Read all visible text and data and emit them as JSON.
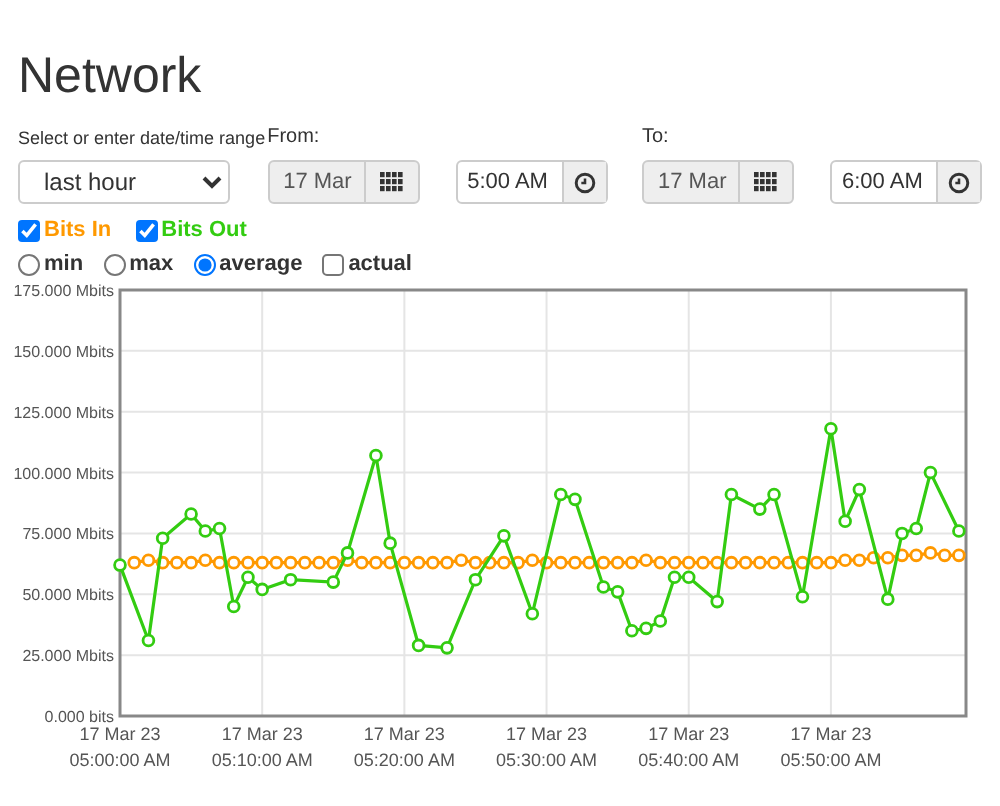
{
  "title": "Network",
  "range": {
    "label": "Select or enter date/time range",
    "value": "last hour"
  },
  "from": {
    "label": "From:",
    "date": "17 Mar",
    "time": "5:00 AM"
  },
  "to": {
    "label": "To:",
    "date": "17 Mar",
    "time": "6:00 AM"
  },
  "series_toggles": [
    {
      "checked": true
    },
    {
      "checked": true
    }
  ],
  "modes": [
    {
      "label": "min",
      "kind": "radio",
      "selected": false
    },
    {
      "label": "max",
      "kind": "radio",
      "selected": false
    },
    {
      "label": "average",
      "kind": "radio",
      "selected": true
    },
    {
      "label": "actual",
      "kind": "checkbox",
      "selected": false
    }
  ],
  "chart": {
    "chart_data": {
      "type": "line",
      "categories": [
        "17 Mar 23 05:00:00 AM",
        null,
        null,
        null,
        null,
        null,
        null,
        null,
        null,
        null,
        "17 Mar 23 05:10:00 AM",
        null,
        null,
        null,
        null,
        null,
        null,
        null,
        null,
        null,
        "17 Mar 23 05:20:00 AM",
        null,
        null,
        null,
        null,
        null,
        null,
        null,
        null,
        null,
        "17 Mar 23 05:30:00 AM",
        null,
        null,
        null,
        null,
        null,
        null,
        null,
        null,
        null,
        "17 Mar 23 05:40:00 AM",
        null,
        null,
        null,
        null,
        null,
        null,
        null,
        null,
        null,
        "17 Mar 23 05:50:00 AM",
        null,
        null,
        null,
        null,
        null,
        null,
        null,
        null,
        null
      ],
      "ylim": [
        0,
        175
      ],
      "grid": true,
      "yticks": [
        {
          "value": 0,
          "label": "0.000 bits"
        },
        {
          "value": 25,
          "label": "25.000 Mbits"
        },
        {
          "value": 50,
          "label": "50.000 Mbits"
        },
        {
          "value": 75,
          "label": "75.000 Mbits"
        },
        {
          "value": 100,
          "label": "100.000 Mbits"
        },
        {
          "value": 125,
          "label": "125.000 Mbits"
        },
        {
          "value": 150,
          "label": "150.000 Mbits"
        },
        {
          "value": 175,
          "label": "175.000 Mbits"
        }
      ],
      "series": [
        {
          "name": "Bits In",
          "color": "#ff9900",
          "marker": "circle",
          "values": [
            null,
            63,
            64,
            63,
            63,
            63,
            64,
            63,
            63,
            63,
            63,
            63,
            63,
            63,
            63,
            63,
            64,
            63,
            63,
            63,
            63,
            63,
            63,
            63,
            64,
            63,
            63,
            63,
            63,
            64,
            63,
            63,
            63,
            63,
            63,
            63,
            63,
            64,
            63,
            63,
            63,
            63,
            63,
            63,
            63,
            63,
            63,
            63,
            63,
            63,
            63,
            64,
            64,
            65,
            65,
            66,
            66,
            67,
            66,
            66
          ]
        },
        {
          "name": "Bits Out",
          "color": "#33cc11",
          "marker": "circle",
          "values": [
            62,
            null,
            31,
            73,
            null,
            83,
            76,
            77,
            45,
            57,
            52,
            null,
            56,
            null,
            null,
            55,
            67,
            null,
            107,
            71,
            null,
            29,
            null,
            28,
            null,
            56,
            null,
            74,
            null,
            42,
            null,
            91,
            89,
            null,
            53,
            51,
            35,
            36,
            39,
            57,
            57,
            null,
            47,
            91,
            null,
            85,
            91,
            null,
            49,
            null,
            118,
            80,
            93,
            null,
            48,
            75,
            77,
            100,
            null,
            76
          ]
        }
      ]
    }
  }
}
